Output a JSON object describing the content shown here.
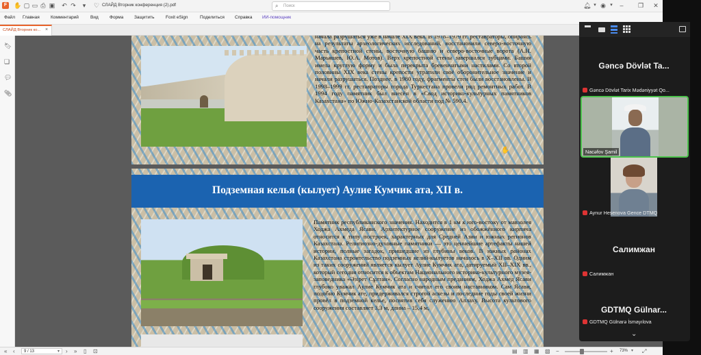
{
  "titlebar": {
    "file_title": "СЛАЙД Вторник конференция (2).pdf",
    "search_placeholder": "Поиск"
  },
  "menu": [
    "Файл",
    "Главная",
    "Комментарий",
    "Вид",
    "Форма",
    "Защитить",
    "Foxit eSign",
    "Поделиться",
    "Справка",
    "ИИ-помощник"
  ],
  "tab": {
    "label": "СЛАЙД Вторник ко..."
  },
  "page1": {
    "text": "начала разрушаться уже в начале XIX века. В 1978–1979 гг. реставраторы, опираясь на результаты археологических исследований, восстановили северо-восточную часть крепостной стены, восточную башню и северо-восточные ворота (А.Н. Марьяшев, Ю.А. Мотов). Верх крепостной стены завершался зубцами. Башня имела круглую форму и была перекрыта бревенчатыми настилами. Со второй половины XIX века стены крепости утратили своё оборонительное значение и начали разрушаться. Позднее, в 1980 году, фрагменты стен были восстановлены. В 1998–1999 гг. реставраторы города Туркестана провели ряд ремонтных работ. В 1994 году памятник был внесён в «Свод историко-культурных памятников Казахстана» по Южно-Казахстанской области под № 590.4."
  },
  "page2": {
    "heading": "Подземная келья (кылует) Аулие Кумчик ата, XII в.",
    "text": "Памятник республиканского значения. Находится в 1 км к юго-востоку от мавзолея Ходжа Ахмеда Ясави. Архитектурное сооружение из обожжённого кирпича относится к типу построек, характерных для Средней Азии и южных регионов Казахстана. Религиозно-духовные памятники — это ценнейшие артефакты нашей истории, полные загадок, пришедшие из глубины веков. В южных районах Казахстана строительство подземных келий-кылуетов началось в X–XII вв. Одним из таких сооружений является кылует Аулие Кумчик ата, датируемый XII–XIX вв., который сегодня относится к объектам Национального историко-культурного музея-заповедника «Әзірет Сұлтан». Согласно народным преданиям, Ходжа Ахмед Ясави глубоко уважал Аулие Кумчик ата и считал его своим наставником. Сам Ясави, подобно Кумчик ате, придерживался строгой аскезы и последние годы своей жизни провёл в подземной келье, посвятив себя служению Аллаху. Высота культового сооружения составляет 3,3 м, длина – 15,4 м,"
  },
  "status": {
    "page_field": "9 / 13",
    "zoom": "73%"
  },
  "participants": [
    {
      "big": "Gəncə Dövlət Ta...",
      "label": "Gəncə Dövlət Tarix Mədəniyyət Qo..."
    },
    {
      "big": "",
      "label": "Nacəfov Şamil"
    },
    {
      "big": "",
      "label": "Aynur Hesenova Gence DTMQ"
    },
    {
      "big": "Салимжан",
      "label": "Салимжан"
    },
    {
      "big": "GDTMQ Gülnar...",
      "label": "GDTMQ Gülnarə İsmayılova"
    }
  ],
  "colors": {
    "accent": "#3c8cc8",
    "speaker_border": "#4cc24c",
    "heading_band": "#1b63b0"
  }
}
